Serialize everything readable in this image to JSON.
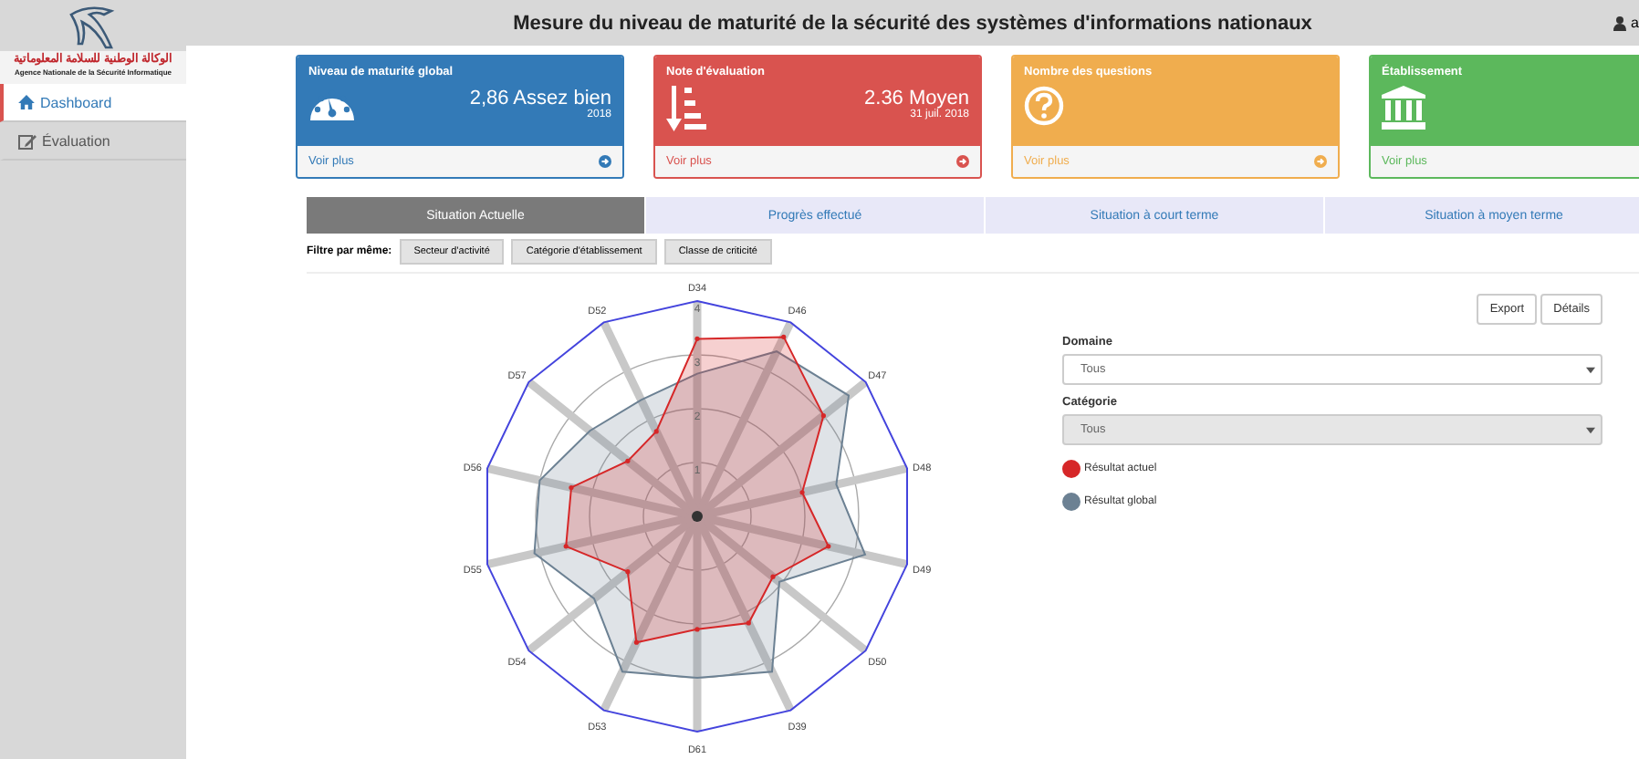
{
  "sidebar": {
    "logo_arabic": "الوكالة الوطنية للسلامة المعلوماتية",
    "logo_name": "Agence Nationale de la Sécurité Informatique",
    "items": [
      {
        "label": "Dashboard",
        "selected": true
      },
      {
        "label": "Évaluation",
        "selected": false
      }
    ]
  },
  "header": {
    "title": "Mesure du niveau de maturité de la sécurité des systèmes d'informations nationaux",
    "user": "a"
  },
  "cards": [
    {
      "title": "Niveau de maturité global",
      "value": "2,86 Assez bien",
      "sub": "2018",
      "link": "Voir plus",
      "color": "#337ab7"
    },
    {
      "title": "Note d'évaluation",
      "value": "2.36 Moyen",
      "sub": "31 juil. 2018",
      "link": "Voir plus",
      "color": "#d9534f"
    },
    {
      "title": "Nombre des questions",
      "link": "Voir plus",
      "color": "#f0ad4e"
    },
    {
      "title": "Établissement",
      "link": "Voir plus",
      "color": "#5cb85c"
    }
  ],
  "tabs": [
    {
      "label": "Situation Actuelle",
      "selected": true
    },
    {
      "label": "Progrès effectué",
      "selected": false
    },
    {
      "label": "Situation à court terme",
      "selected": false
    },
    {
      "label": "Situation à moyen terme",
      "selected": false
    }
  ],
  "filter": {
    "label": "Filtre par même:",
    "buttons": [
      "Secteur d'activité",
      "Catégorie d'établissement",
      "Classe de criticité"
    ]
  },
  "chart_data": {
    "type": "radar",
    "categories": [
      "D34",
      "D46",
      "D47",
      "D48",
      "D49",
      "D50",
      "D39",
      "D61",
      "D53",
      "D54",
      "D55",
      "D56",
      "D57",
      "D52"
    ],
    "ylim": [
      0,
      4
    ],
    "yticks": [
      1,
      2,
      3,
      4
    ],
    "series": [
      {
        "name": "Résultat actuel",
        "color": "#d62728",
        "values": [
          3.3,
          3.7,
          3.0,
          2.0,
          2.5,
          1.8,
          2.2,
          2.1,
          2.6,
          1.65,
          2.5,
          2.4,
          1.65,
          1.75
        ]
      },
      {
        "name": "Résultat global",
        "color": "#6c8193",
        "values": [
          2.65,
          3.4,
          3.6,
          2.65,
          3.2,
          1.95,
          3.2,
          3.0,
          3.2,
          2.45,
          3.1,
          3.0,
          2.55,
          2.4
        ]
      }
    ]
  },
  "actions": [
    "Export",
    "Détails"
  ],
  "fields": [
    {
      "label": "Domaine",
      "value": "Tous",
      "disabled": false
    },
    {
      "label": "Catégorie",
      "value": "Tous",
      "disabled": true
    }
  ]
}
